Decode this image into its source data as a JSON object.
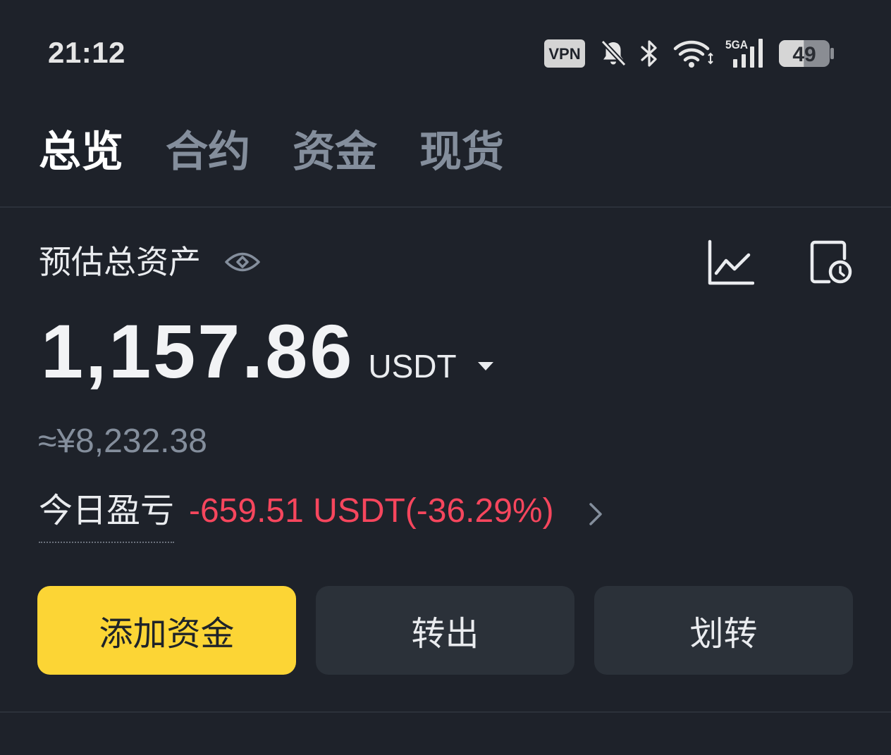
{
  "status_bar": {
    "time": "21:12",
    "vpn_label": "VPN",
    "network_label": "5GA",
    "battery_level": "49",
    "icons": [
      "mute-icon",
      "bluetooth-icon",
      "wifi-icon",
      "signal-icon",
      "battery-icon"
    ]
  },
  "tabs": [
    {
      "label": "总览",
      "active": true
    },
    {
      "label": "合约",
      "active": false
    },
    {
      "label": "资金",
      "active": false
    },
    {
      "label": "现货",
      "active": false
    }
  ],
  "assets": {
    "label": "预估总资产",
    "total": "1,157.86",
    "currency": "USDT",
    "cny_equivalent": "≈¥8,232.38",
    "icons": [
      "eye-icon",
      "chart-icon",
      "history-icon",
      "dropdown-arrow-icon"
    ]
  },
  "pnl": {
    "label": "今日盈亏",
    "value": "-659.51 USDT(-36.29%)",
    "icon": "chevron-right-icon"
  },
  "actions": {
    "deposit": "添加资金",
    "withdraw": "转出",
    "transfer": "划转"
  },
  "colors": {
    "background": "#1E222A",
    "text_primary": "#EAECEF",
    "text_secondary": "#848E9C",
    "accent": "#FCD535",
    "loss": "#F6465D",
    "button_secondary": "#2B3139"
  }
}
